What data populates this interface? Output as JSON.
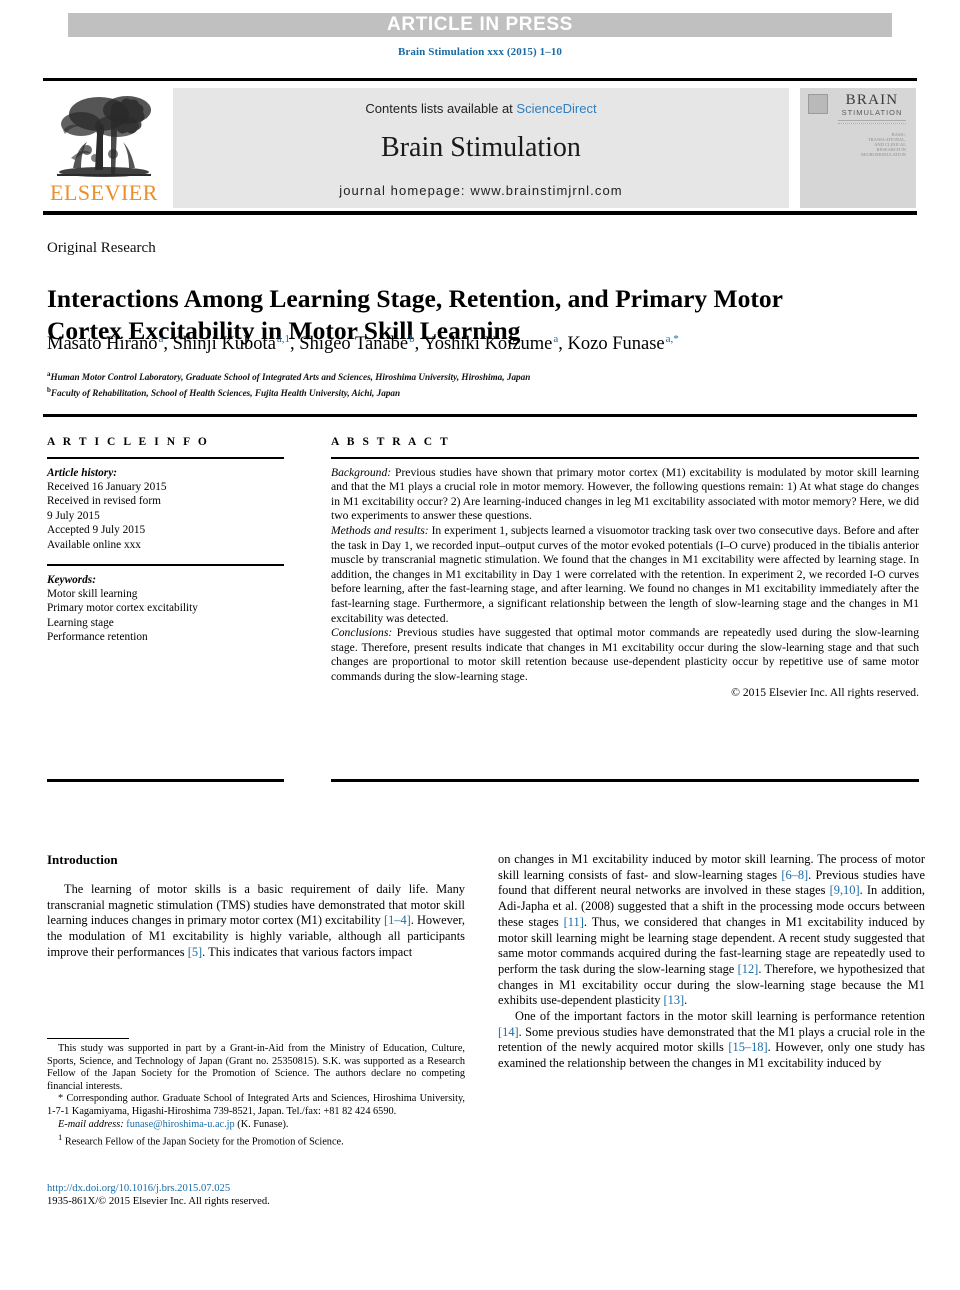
{
  "banner": {
    "label": "ARTICLE IN PRESS",
    "bg": "#c0c0c0",
    "text_color": "#ffffff"
  },
  "journal_ref": "Brain Stimulation xxx (2015) 1–10",
  "masthead": {
    "publisher_name": "ELSEVIER",
    "publisher_color": "#ea8f2b",
    "contents_prefix": "Contents lists available at ",
    "contents_link": "ScienceDirect",
    "journal_title": "Brain Stimulation",
    "homepage": "journal homepage: www.brainstimjrnl.com",
    "cover": {
      "title": "BRAIN",
      "subtitle": "STIMULATION",
      "caption": "BASIC, TRANSLATIONAL, AND CLINICAL RESEARCH IN NEUROMODULATION"
    },
    "link_color": "#2e7fc1"
  },
  "article": {
    "category": "Original Research",
    "title": "Interactions Among Learning Stage, Retention, and Primary Motor Cortex Excitability in Motor Skill Learning",
    "authors": [
      {
        "name": "Masato Hirano",
        "sup": "a"
      },
      {
        "name": "Shinji Kubota",
        "sup": "a,1"
      },
      {
        "name": "Shigeo Tanabe",
        "sup": "b"
      },
      {
        "name": "Yoshiki Koizume",
        "sup": "a"
      },
      {
        "name": "Kozo Funase",
        "sup": "a,*"
      }
    ],
    "affiliations": [
      {
        "marker": "a",
        "text": "Human Motor Control Laboratory, Graduate School of Integrated Arts and Sciences, Hiroshima University, Hiroshima, Japan"
      },
      {
        "marker": "b",
        "text": "Faculty of Rehabilitation, School of Health Sciences, Fujita Health University, Aichi, Japan"
      }
    ]
  },
  "article_info": {
    "heading": "A R T I C L E  I N F O",
    "history_label": "Article history:",
    "history": [
      "Received 16 January 2015",
      "Received in revised form",
      "9 July 2015",
      "Accepted 9 July 2015",
      "Available online xxx"
    ],
    "keywords_label": "Keywords:",
    "keywords": [
      "Motor skill learning",
      "Primary motor cortex excitability",
      "Learning stage",
      "Performance retention"
    ]
  },
  "abstract": {
    "heading": "A B S T R A C T",
    "background_label": "Background:",
    "background": " Previous studies have shown that primary motor cortex (M1) excitability is modulated by motor skill learning and that the M1 plays a crucial role in motor memory. However, the following questions remain: 1) At what stage do changes in M1 excitability occur? 2) Are learning-induced changes in leg M1 excitability associated with motor memory? Here, we did two experiments to answer these questions.",
    "methods_label": "Methods and results:",
    "methods": " In experiment 1, subjects learned a visuomotor tracking task over two consecutive days. Before and after the task in Day 1, we recorded input–output curves of the motor evoked potentials (I–O curve) produced in the tibialis anterior muscle by transcranial magnetic stimulation. We found that the changes in M1 excitability were affected by learning stage. In addition, the changes in M1 excitability in Day 1 were correlated with the retention. In experiment 2, we recorded I-O curves before learning, after the fast-learning stage, and after learning. We found no changes in M1 excitability immediately after the fast-learning stage. Furthermore, a significant relationship between the length of slow-learning stage and the changes in M1 excitability was detected.",
    "conclusions_label": "Conclusions:",
    "conclusions": " Previous studies have suggested that optimal motor commands are repeatedly used during the slow-learning stage. Therefore, present results indicate that changes in M1 excitability occur during the slow-learning stage and that such changes are proportional to motor skill retention because use-dependent plasticity occur by repetitive use of same motor commands during the slow-learning stage.",
    "copyright": "© 2015 Elsevier Inc. All rights reserved."
  },
  "introduction": {
    "heading": "Introduction",
    "left_paragraph_1_a": "The learning of motor skills is a basic requirement of daily life. Many transcranial magnetic stimulation (TMS) studies have demonstrated that motor skill learning induces changes in primary motor cortex (M1) excitability ",
    "left_ref_1": "[1–4]",
    "left_paragraph_1_b": ". However, the modulation of M1 excitability is highly variable, although all participants improve their performances ",
    "left_ref_2": "[5]",
    "left_paragraph_1_c": ". This indicates that various factors impact",
    "right_p1_a": "on changes in M1 excitability induced by motor skill learning. The process of motor skill learning consists of fast- and slow-learning stages ",
    "right_ref_1": "[6–8]",
    "right_p1_b": ". Previous studies have found that different neural networks are involved in these stages ",
    "right_ref_2": "[9,10]",
    "right_p1_c": ". In addition, Adi-Japha et al. (2008) suggested that a shift in the processing mode occurs between these stages ",
    "right_ref_3": "[11]",
    "right_p1_d": ". Thus, we considered that changes in M1 excitability induced by motor skill learning might be learning stage dependent. A recent study suggested that same motor commands acquired during the fast-learning stage are repeatedly used to perform the task during the slow-learning stage ",
    "right_ref_4": "[12]",
    "right_p1_e": ". Therefore, we hypothesized that changes in M1 excitability occur during the slow-learning stage because the M1 exhibits use-dependent plasticity ",
    "right_ref_5": "[13]",
    "right_p1_f": ".",
    "right_p2_a": "One of the important factors in the motor skill learning is performance retention ",
    "right_p2_ref_1": "[14]",
    "right_p2_b": ". Some previous studies have demonstrated that the M1 plays a crucial role in the retention of the newly acquired motor skills ",
    "right_p2_ref_2": "[15–18]",
    "right_p2_c": ". However, only one study has examined the relationship between the changes in M1 excitability induced by"
  },
  "footnotes": {
    "funding": "This study was supported in part by a Grant-in-Aid from the Ministry of Education, Culture, Sports, Science, and Technology of Japan (Grant no. 25350815). S.K. was supported as a Research Fellow of the Japan Society for the Promotion of Science. The authors declare no competing financial interests.",
    "corresponding": "* Corresponding author. Graduate School of Integrated Arts and Sciences, Hiroshima University, 1-7-1 Kagamiyama, Higashi-Hiroshima 739-8521, Japan. Tel./fax: +81 82 424 6590.",
    "email_label": "E-mail address:",
    "email": "funase@hiroshima-u.ac.jp",
    "email_suffix": " (K. Funase).",
    "fellow_marker": "1",
    "fellow": " Research Fellow of the Japan Society for the Promotion of Science.",
    "doi": "http://dx.doi.org/10.1016/j.brs.2015.07.025",
    "issn": "1935-861X/© 2015 Elsevier Inc. All rights reserved."
  },
  "colors": {
    "link": "#1a6ba5",
    "banner_bg": "#c0c0c0",
    "masthead_bg": "#e6e6e6",
    "cover_bg": "#d6d6d6",
    "elsevier_orange": "#ea8f2b"
  }
}
